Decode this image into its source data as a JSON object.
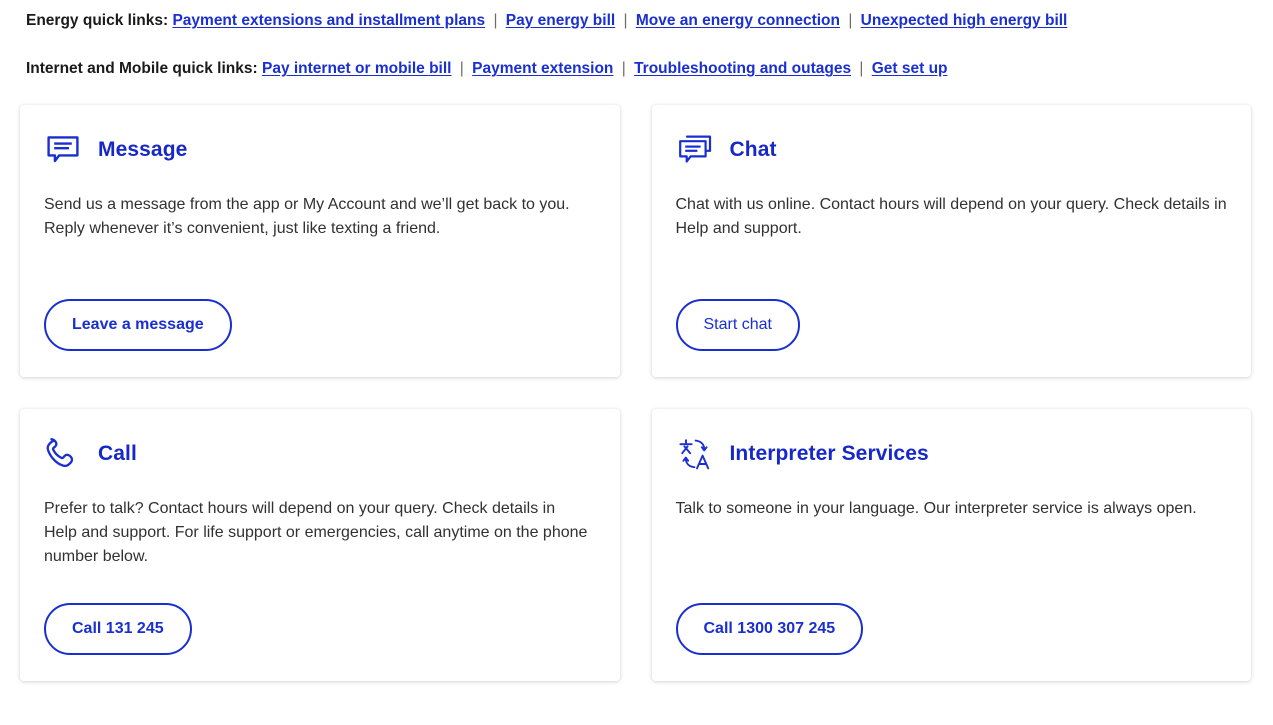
{
  "quick_links": [
    {
      "label": "Energy quick links:",
      "links": [
        "Payment extensions and installment plans",
        "Pay energy bill",
        "Move an energy connection",
        "Unexpected high energy bill"
      ]
    },
    {
      "label": "Internet and Mobile quick links:",
      "links": [
        "Pay internet or mobile bill",
        "Payment extension",
        "Troubleshooting and outages",
        "Get set up "
      ]
    }
  ],
  "separator": "|",
  "colors": {
    "link": "#1a2fd0",
    "heading": "#1728c8",
    "body_text": "#313131",
    "card_background": "#ffffff",
    "page_background": "#ffffff"
  },
  "cards": [
    {
      "icon": "message-bubble-icon",
      "title": "Message",
      "body": "Send us a message from the app or My Account and we’ll get back to you. Reply whenever it’s convenient, just like texting a friend.",
      "button": "Leave a message"
    },
    {
      "icon": "chat-bubbles-icon",
      "title": "Chat",
      "body": "Chat with us online. Contact hours will depend on your query. Check details in Help and support.",
      "button": "Start chat"
    },
    {
      "icon": "phone-handset-icon",
      "title": "Call",
      "body": "Prefer to talk? Contact hours will depend on your query. Check details in Help and support. For life support or emergencies, call anytime on the phone number below.",
      "button": "Call 131 245"
    },
    {
      "icon": "translate-icon",
      "title": "Interpreter Services",
      "body": "Talk to someone in your language. Our interpreter service is always open.",
      "button": "Call 1300 307 245"
    }
  ]
}
